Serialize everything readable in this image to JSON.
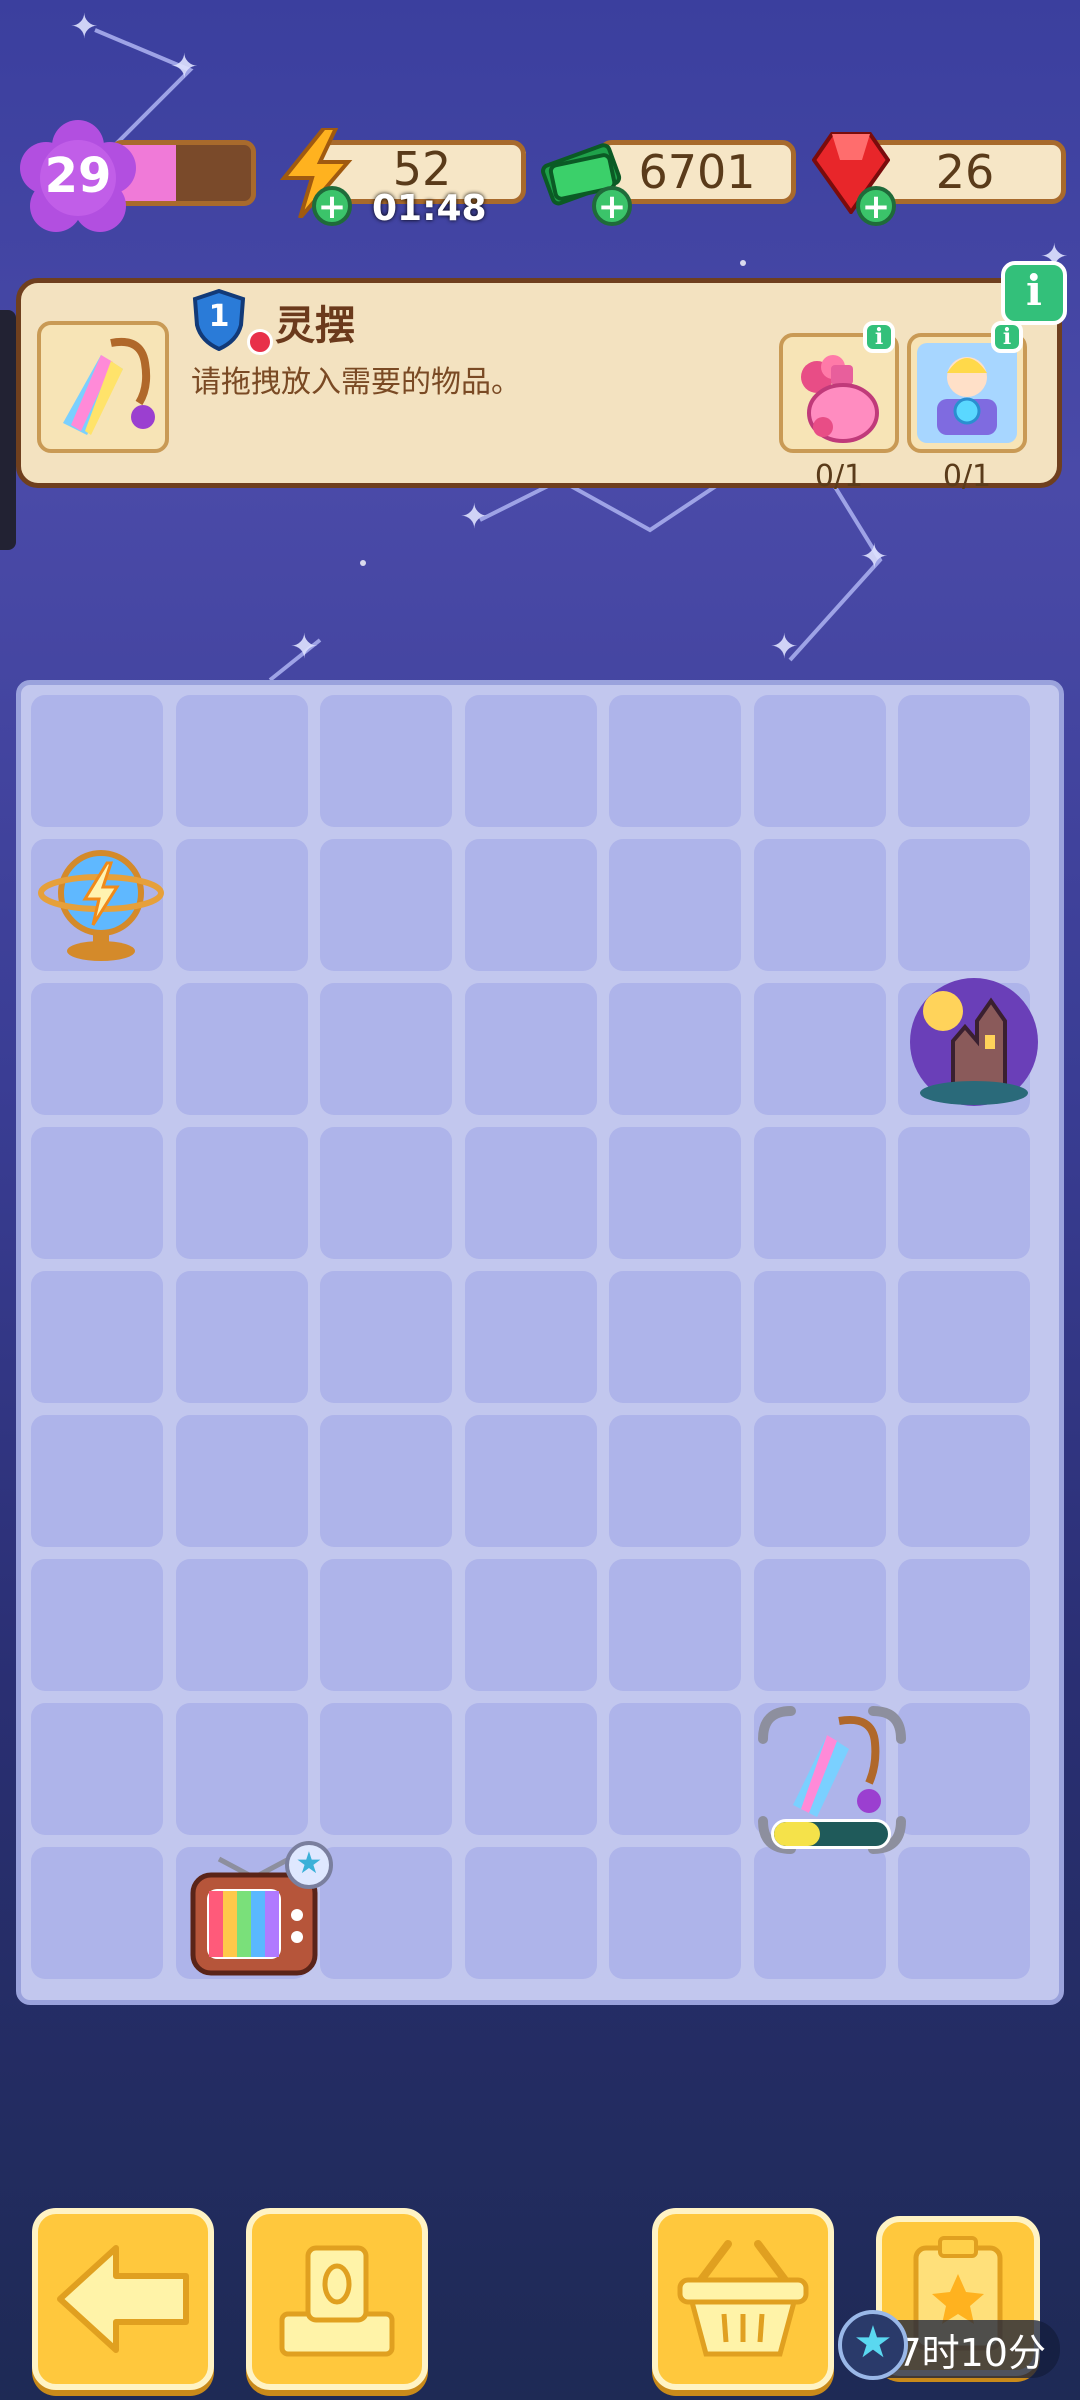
{
  "hud": {
    "level": "29",
    "level_progress": 0.45,
    "energy": "52",
    "energy_timer": "01:48",
    "cash": "6701",
    "gems": "26"
  },
  "order": {
    "item_name": "灵摆",
    "level_badge": "1",
    "instruction": "请拖拽放入需要的物品。",
    "requirements": [
      {
        "icon": "pink-perfume-icon",
        "progress": "0/1"
      },
      {
        "icon": "fortune-teller-icon",
        "progress": "0/1"
      }
    ]
  },
  "board": {
    "columns": 7,
    "rows": 9,
    "items": [
      {
        "icon": "energy-globe-icon",
        "row": 2,
        "col": 1
      },
      {
        "icon": "haunted-castle-icon",
        "row": 3,
        "col": 7
      },
      {
        "icon": "rainbow-pendulum-icon",
        "row": 8,
        "col": 6,
        "selected": true,
        "progress": 0.4
      },
      {
        "icon": "retro-tv-icon",
        "row": 9,
        "col": 2
      }
    ]
  },
  "bottom_bar": {
    "buttons": [
      "back-arrow-icon",
      "coin-stand-icon",
      "basket-icon",
      "task-board-icon"
    ],
    "timer": "17时10分"
  },
  "colors": {
    "accent": "#ffc83d",
    "panel": "#f3e2c0",
    "board": "#c2c7ee",
    "cell": "#aeb4ea"
  }
}
